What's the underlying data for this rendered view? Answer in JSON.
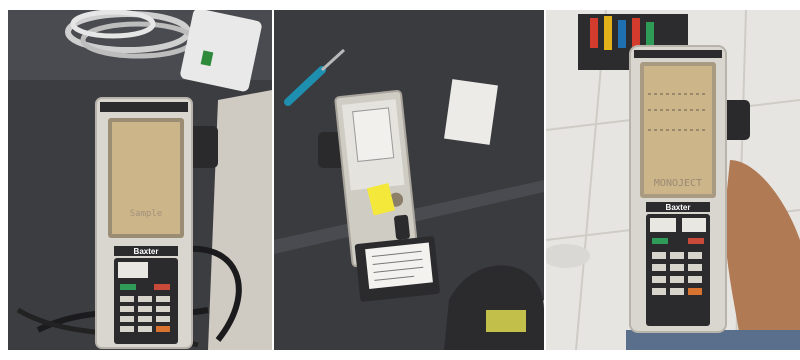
{
  "photos": [
    {
      "id": "left",
      "device_brand": "Baxter",
      "screen_text": "Sample"
    },
    {
      "id": "middle",
      "device_brand": "",
      "screen_text": ""
    },
    {
      "id": "right",
      "device_brand": "Baxter",
      "screen_text": "MONOJECT"
    }
  ],
  "colors": {
    "device_body": "#d9d6cf",
    "keypad": "#2b2b2e",
    "key_green": "#2e9b57",
    "key_red": "#c94a3a",
    "key_orange": "#d8742f",
    "table_dark": "#3a3b3f",
    "lcd_amber": "#cdb58a",
    "tile_floor": "#e7e5e1",
    "sticky_note": "#f4e83a"
  }
}
